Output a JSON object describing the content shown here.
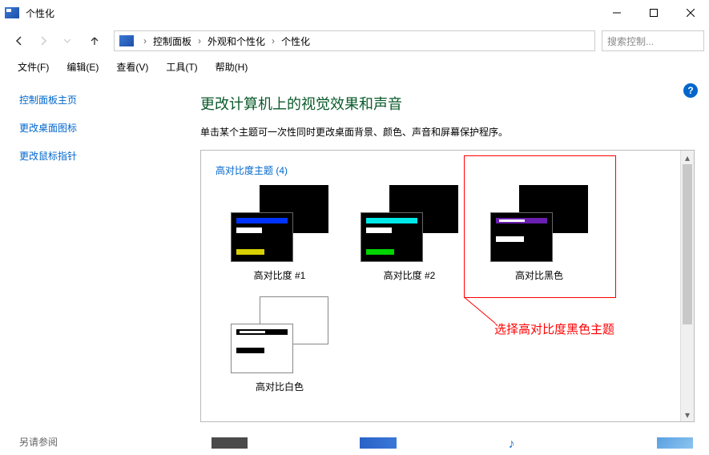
{
  "window": {
    "title": "个性化"
  },
  "breadcrumbs": {
    "seg1": "控制面板",
    "seg2": "外观和个性化",
    "seg3": "个性化"
  },
  "search": {
    "placeholder": "搜索控制..."
  },
  "menu": {
    "file": "文件(F)",
    "edit": "编辑(E)",
    "view": "查看(V)",
    "tools": "工具(T)",
    "help": "帮助(H)"
  },
  "help_icon": "?",
  "sidebar": {
    "link1": "控制面板主页",
    "link2": "更改桌面图标",
    "link3": "更改鼠标指针",
    "see_also": "另请参阅"
  },
  "main": {
    "heading": "更改计算机上的视觉效果和声音",
    "subtitle": "单击某个主题可一次性同时更改桌面背景、颜色、声音和屏幕保护程序。"
  },
  "themes": {
    "section_title": "高对比度主题 (4)",
    "items": [
      {
        "label": "高对比度 #1"
      },
      {
        "label": "高对比度 #2"
      },
      {
        "label": "高对比黑色"
      },
      {
        "label": "高对比白色"
      }
    ]
  },
  "annotation": {
    "text": "选择高对比度黑色主题"
  }
}
